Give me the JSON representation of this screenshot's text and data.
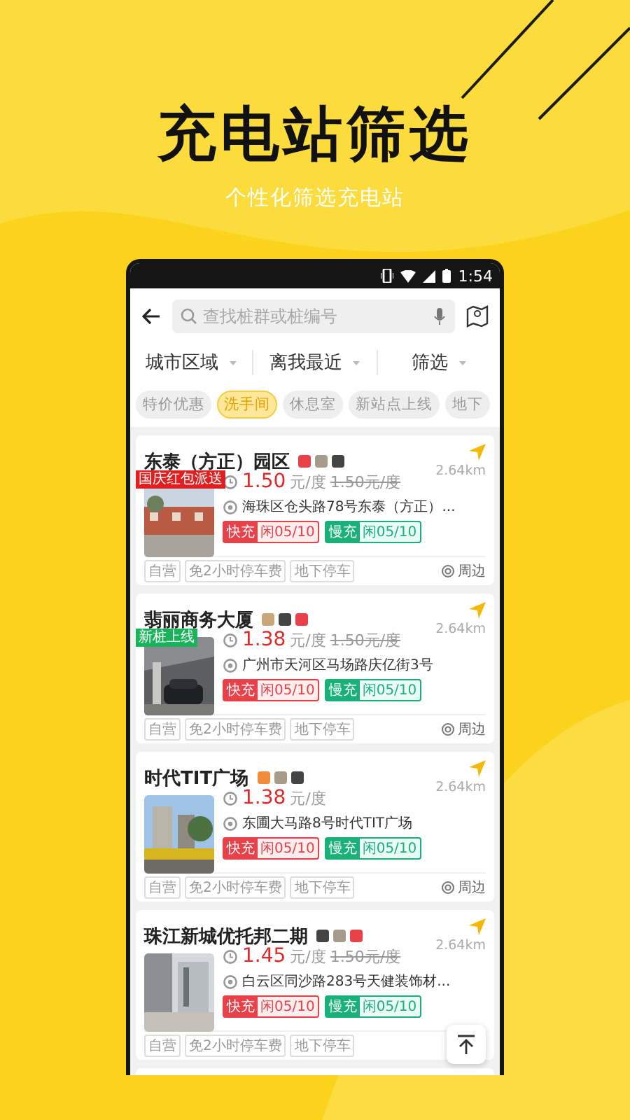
{
  "hero": {
    "title": "充电站筛选",
    "subtitle": "个性化筛选充电站"
  },
  "status_bar": {
    "time": "1:54"
  },
  "search": {
    "placeholder": "查找桩群或桩编号"
  },
  "filters": [
    {
      "label": "城市区域"
    },
    {
      "label": "离我最近"
    },
    {
      "label": "筛选"
    }
  ],
  "chips": [
    {
      "label": "特价优惠",
      "selected": false
    },
    {
      "label": "洗手间",
      "selected": true
    },
    {
      "label": "休息室",
      "selected": false
    },
    {
      "label": "新站点上线",
      "selected": false
    },
    {
      "label": "地下",
      "selected": false
    }
  ],
  "stations": [
    {
      "name": "东泰（方正）园区",
      "badges": [
        {
          "color": "#e8414a"
        },
        {
          "color": "#a89a8a"
        },
        {
          "color": "#444444"
        }
      ],
      "distance": "2.64km",
      "ribbon": {
        "text": "国庆红包派送",
        "color": "#e02020"
      },
      "picture": {
        "kind": "picture"
      },
      "price": "1.50",
      "unit": "元/度",
      "original_price": "1.50元/度",
      "address": "海珠区仓头路78号东泰（方正）...",
      "fast": {
        "label": "快充",
        "count": "闲05/10"
      },
      "slow": {
        "label": "慢充",
        "count": "闲05/10"
      },
      "tags": [
        "自营",
        "免2小时停车费",
        "地下停车"
      ],
      "nearby": "周边"
    },
    {
      "name": "翡丽商务大厦",
      "badges": [
        {
          "color": "#c8a878"
        },
        {
          "color": "#444444"
        },
        {
          "color": "#e8414a"
        }
      ],
      "distance": "2.64km",
      "ribbon": {
        "text": "新桩上线",
        "color": "#19b45a"
      },
      "picture": {
        "kind": "picture"
      },
      "price": "1.38",
      "unit": "元/度",
      "original_price": "1.50元/度",
      "address": "广州市天河区马场路庆亿街3号",
      "fast": {
        "label": "快充",
        "count": "闲05/10"
      },
      "slow": {
        "label": "慢充",
        "count": "闲05/10"
      },
      "tags": [
        "自营",
        "免2小时停车费",
        "地下停车"
      ],
      "nearby": "周边"
    },
    {
      "name": "时代TIT广场",
      "badges": [
        {
          "color": "#f08c3c"
        },
        {
          "color": "#a89a8a"
        },
        {
          "color": "#444444"
        }
      ],
      "distance": "2.64km",
      "picture": {
        "kind": "picture"
      },
      "price": "1.38",
      "unit": "元/度",
      "address": "东圃大马路8号时代TIT广场",
      "fast": {
        "label": "快充",
        "count": "闲05/10"
      },
      "slow": {
        "label": "慢充",
        "count": "闲05/10"
      },
      "tags": [
        "自营",
        "免2小时停车费",
        "地下停车"
      ],
      "nearby": "周边"
    },
    {
      "name": "珠江新城优托邦二期",
      "badges": [
        {
          "color": "#444444"
        },
        {
          "color": "#a89a8a"
        },
        {
          "color": "#e8414a"
        }
      ],
      "distance": "2.64km",
      "picture": {
        "kind": "picture"
      },
      "price": "1.45",
      "unit": "元/度",
      "original_price": "1.50元/度",
      "address": "白云区同沙路283号天健装饰材...",
      "fast": {
        "label": "快充",
        "count": "闲05/10"
      },
      "slow": {
        "label": "慢充",
        "count": "闲05/10"
      },
      "tags": [
        "自营",
        "免2小时停车费",
        "地下停车"
      ]
    }
  ]
}
